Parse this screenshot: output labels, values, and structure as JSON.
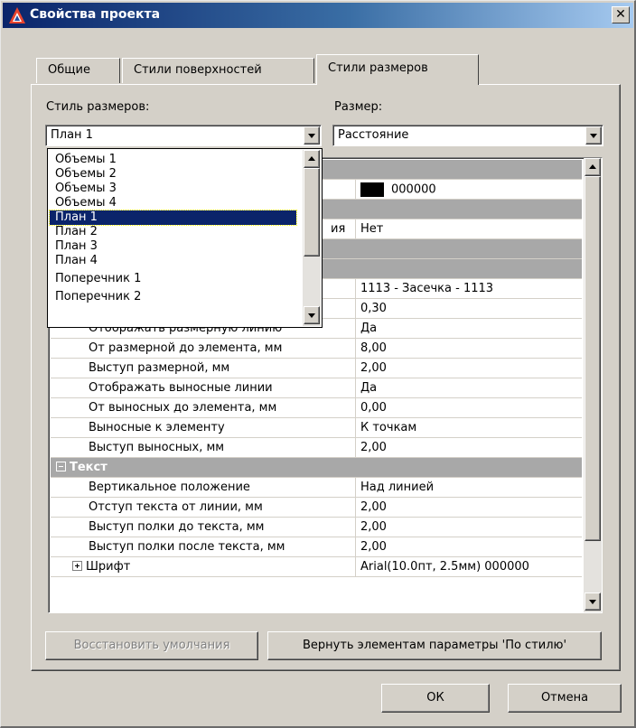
{
  "window": {
    "title": "Свойства проекта",
    "close_label": "✕"
  },
  "tabs": [
    {
      "label": "Общие"
    },
    {
      "label": "Стили поверхностей"
    },
    {
      "label": "Стили размеров"
    }
  ],
  "style_field": {
    "label": "Стиль размеров:",
    "value": "План 1"
  },
  "size_field": {
    "label": "Размер:",
    "value": "Расстояние"
  },
  "style_dropdown": {
    "items": [
      "Объемы 1",
      "Объемы 2",
      "Объемы 3",
      "Объемы 4",
      "План 1",
      "План 2",
      "План 3",
      "План 4",
      "Поперечник 1",
      "Поперечник 2"
    ],
    "selected_index": 4
  },
  "property_grid": {
    "partial_rows": {
      "color_value": "000000",
      "line_name_tail": "ия",
      "line_value": "Нет",
      "marker_value": "1113 - Засечка - 1113",
      "thickness_value": "0,30"
    },
    "rows": [
      {
        "name": "Отображать размерную линию",
        "value": "Да"
      },
      {
        "name": "От размерной до элемента, мм",
        "value": "8,00"
      },
      {
        "name": "Выступ размерной, мм",
        "value": "2,00"
      },
      {
        "name": "Отображать выносные линии",
        "value": "Да"
      },
      {
        "name": "От выносных до элемента, мм",
        "value": "0,00"
      },
      {
        "name": "Выносные к элементу",
        "value": "К точкам"
      },
      {
        "name": "Выступ выносных, мм",
        "value": "2,00"
      }
    ],
    "text_category": "Текст",
    "text_rows": [
      {
        "name": "Вертикальное положение",
        "value": "Над линией"
      },
      {
        "name": "Отступ текста от линии, мм",
        "value": "2,00"
      },
      {
        "name": "Выступ полки до текста, мм",
        "value": "2,00"
      },
      {
        "name": "Выступ полки после текста, мм",
        "value": "2,00"
      }
    ],
    "font_row": {
      "name": "Шрифт",
      "value": "Arial(10.0пт, 2.5мм) 000000"
    }
  },
  "buttons": {
    "restore_defaults": "Восстановить умолчания",
    "reset_to_style": "Вернуть элементам параметры 'По стилю'",
    "ok": "ОК",
    "cancel": "Отмена"
  },
  "colors": {
    "title_gradient_start": "#0a246a",
    "selection": "#0a246a",
    "category_band": "#a8a8a8",
    "dialog_face": "#d4d0c8"
  }
}
